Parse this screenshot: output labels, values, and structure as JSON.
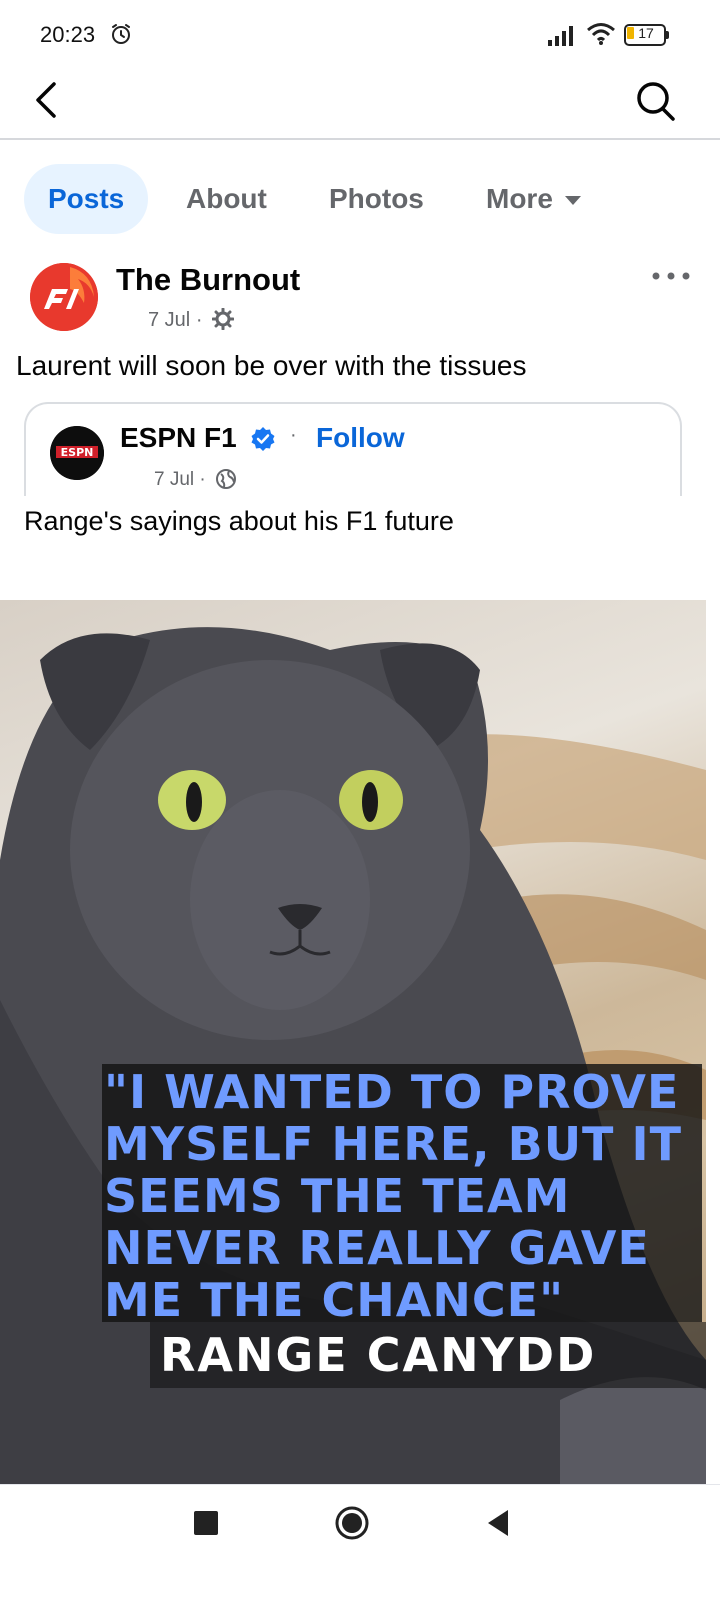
{
  "status_bar": {
    "time": "20:23",
    "battery": "17",
    "alarm_icon": "alarm-clock-icon",
    "signal_icon": "signal-icon",
    "wifi_icon": "wifi-icon"
  },
  "app_bar": {
    "back_icon": "back-arrow-icon",
    "search_icon": "search-icon"
  },
  "tabs": [
    {
      "label": "Posts",
      "active": true
    },
    {
      "label": "About",
      "active": false
    },
    {
      "label": "Photos",
      "active": false
    },
    {
      "label": "More",
      "active": false
    }
  ],
  "post": {
    "author": "The Burnout",
    "date": "7 Jul",
    "separator": "·",
    "privacy_icon": "gear-icon",
    "text": "Laurent will soon be over with the tissues"
  },
  "shared_post": {
    "author": "ESPN F1",
    "verified": true,
    "dot": "·",
    "follow_label": "Follow",
    "date": "7 Jul",
    "separator": "·",
    "privacy_icon": "globe-icon",
    "text": "Range's sayings about his F1 future"
  },
  "image": {
    "quote": "\"I WANTED TO PROVE MYSELF HERE, BUT IT SEEMS THE TEAM NEVER REALLY GAVE ME THE CHANCE\"",
    "quote_lines": [
      "\"I WANTED TO PROVE",
      "MYSELF HERE, BUT IT",
      "SEEMS THE TEAM",
      "NEVER REALLY GAVE",
      "ME THE CHANCE\""
    ],
    "author": "RANGE CANYDD",
    "quote_color": "#6f9bff"
  },
  "nav_bar": {
    "recents_icon": "recents-square-icon",
    "home_icon": "home-circle-icon",
    "back_icon": "back-triangle-icon"
  },
  "colors": {
    "accent": "#0a66d8",
    "tab_active_bg": "#e7f3ff",
    "muted_text": "#65676b",
    "logo_red": "#e33127"
  }
}
